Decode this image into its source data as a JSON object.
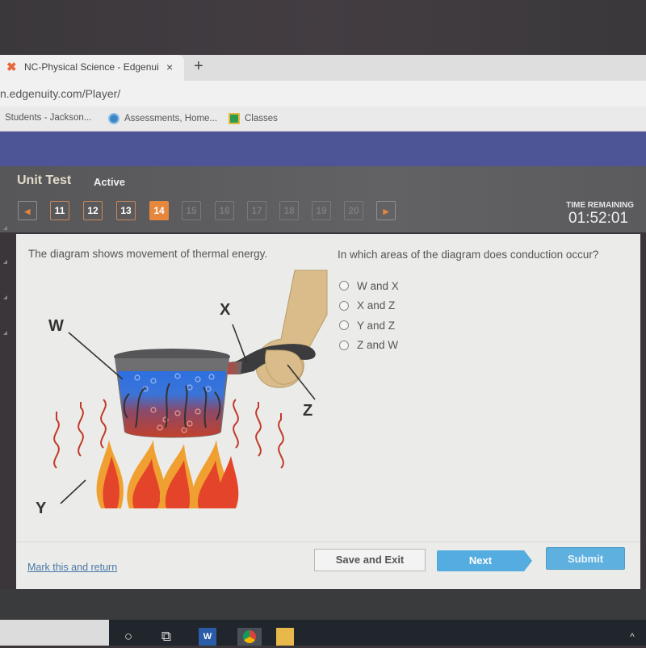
{
  "browser": {
    "tab_title": "NC-Physical Science - Edgenuity",
    "tab_close": "×",
    "new_tab": "+",
    "url": "n.edgenuity.com/Player/",
    "bookmarks": [
      {
        "label": "Students - Jackson...",
        "icon": "none"
      },
      {
        "label": "Assessments, Home...",
        "icon": "globe-icon"
      },
      {
        "label": "Classes",
        "icon": "google-classroom-icon"
      }
    ]
  },
  "header": {
    "title": "Unit Test",
    "status": "Active",
    "prev_arrow": "◀",
    "next_arrow": "▶",
    "questions": [
      {
        "num": "11",
        "state": "answered"
      },
      {
        "num": "12",
        "state": "answered"
      },
      {
        "num": "13",
        "state": "answered"
      },
      {
        "num": "14",
        "state": "current"
      },
      {
        "num": "15",
        "state": "disabled"
      },
      {
        "num": "16",
        "state": "disabled"
      },
      {
        "num": "17",
        "state": "disabled"
      },
      {
        "num": "18",
        "state": "disabled"
      },
      {
        "num": "19",
        "state": "disabled"
      },
      {
        "num": "20",
        "state": "disabled"
      }
    ],
    "timer_label": "TIME REMAINING",
    "timer": "01:52:01"
  },
  "question": {
    "prompt": "The diagram shows movement of thermal energy.",
    "stem": "In which areas of the diagram does conduction occur?",
    "options": [
      "W and X",
      "X and Z",
      "Y and Z",
      "Z and W"
    ],
    "selected": null,
    "diagram_labels": {
      "w": "W",
      "x": "X",
      "y": "Y",
      "z": "Z"
    }
  },
  "footer": {
    "mark_link": "Mark this and return",
    "save_exit": "Save and Exit",
    "next": "Next",
    "submit": "Submit"
  },
  "colors": {
    "accent_orange": "#e6873e",
    "header_band": "#4e5596",
    "button_blue": "#55ace0"
  }
}
